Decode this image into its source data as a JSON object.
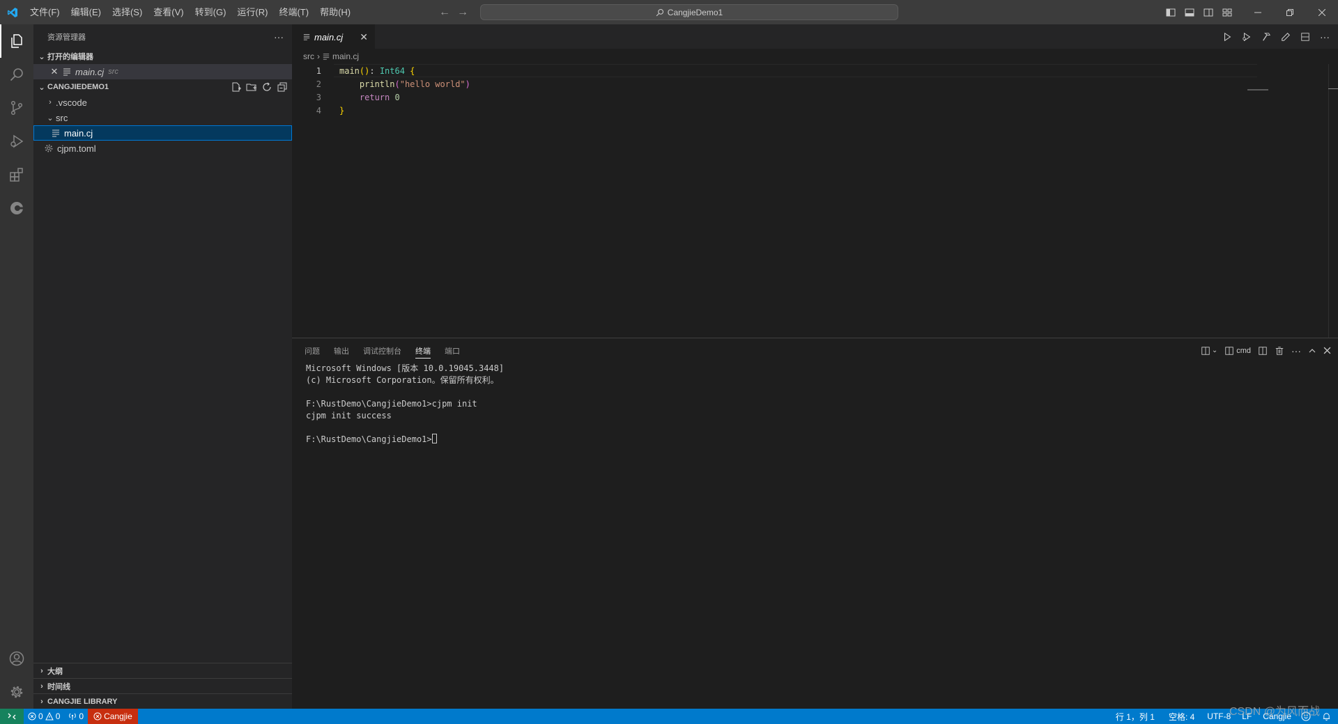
{
  "titlebar": {
    "menus": [
      "文件(F)",
      "编辑(E)",
      "选择(S)",
      "查看(V)",
      "转到(G)",
      "运行(R)",
      "终端(T)",
      "帮助(H)"
    ],
    "search_text": "CangjieDemo1"
  },
  "sidebar": {
    "title": "资源管理器",
    "open_editors_header": "打开的编辑器",
    "open_editor_file": "main.cj",
    "open_editor_folder": "src",
    "project_header": "CANGJIEDEMO1",
    "tree": {
      "vscode": ".vscode",
      "src": "src",
      "main": "main.cj",
      "cjpm": "cjpm.toml"
    },
    "bottom_sections": {
      "outline": "大纲",
      "timeline": "时间线",
      "library": "CANGJIE LIBRARY"
    }
  },
  "editor": {
    "tab_label": "main.cj",
    "breadcrumb": {
      "folder": "src",
      "file": "main.cj"
    },
    "line_numbers": [
      "1",
      "2",
      "3",
      "4"
    ],
    "code": {
      "l1_fn": "main",
      "l1_paren": "()",
      "l1_colon": ": ",
      "l1_type": "Int64",
      "l1_brace": "{",
      "l2_indent": "    ",
      "l2_fn": "println",
      "l2_open": "(",
      "l2_str": "\"hello world\"",
      "l2_close": ")",
      "l3_indent": "    ",
      "l3_kw": "return",
      "l3_num": "0",
      "l4_brace": "}"
    }
  },
  "panel": {
    "tabs": [
      "问题",
      "输出",
      "调试控制台",
      "终端",
      "端口"
    ],
    "active_tab": "终端",
    "shell_label": "cmd",
    "terminal_lines": [
      "Microsoft Windows [版本 10.0.19045.3448]",
      "(c) Microsoft Corporation。保留所有权利。",
      "",
      "F:\\RustDemo\\CangjieDemo1>cjpm init",
      "cjpm init success",
      ""
    ],
    "prompt": "F:\\RustDemo\\CangjieDemo1>"
  },
  "statusbar": {
    "errors": "0",
    "warnings": "0",
    "ports": "0",
    "cangjie": "Cangjie",
    "position": "行 1，列 1",
    "spaces": "空格: 4",
    "encoding": "UTF-8",
    "eol": "LF",
    "language": "Cangjie"
  },
  "watermark": "CSDN @为风而战",
  "colors": {
    "accent": "#007acc",
    "remote": "#16825d",
    "error_item": "#c72e0f",
    "selection": "#04395e"
  }
}
